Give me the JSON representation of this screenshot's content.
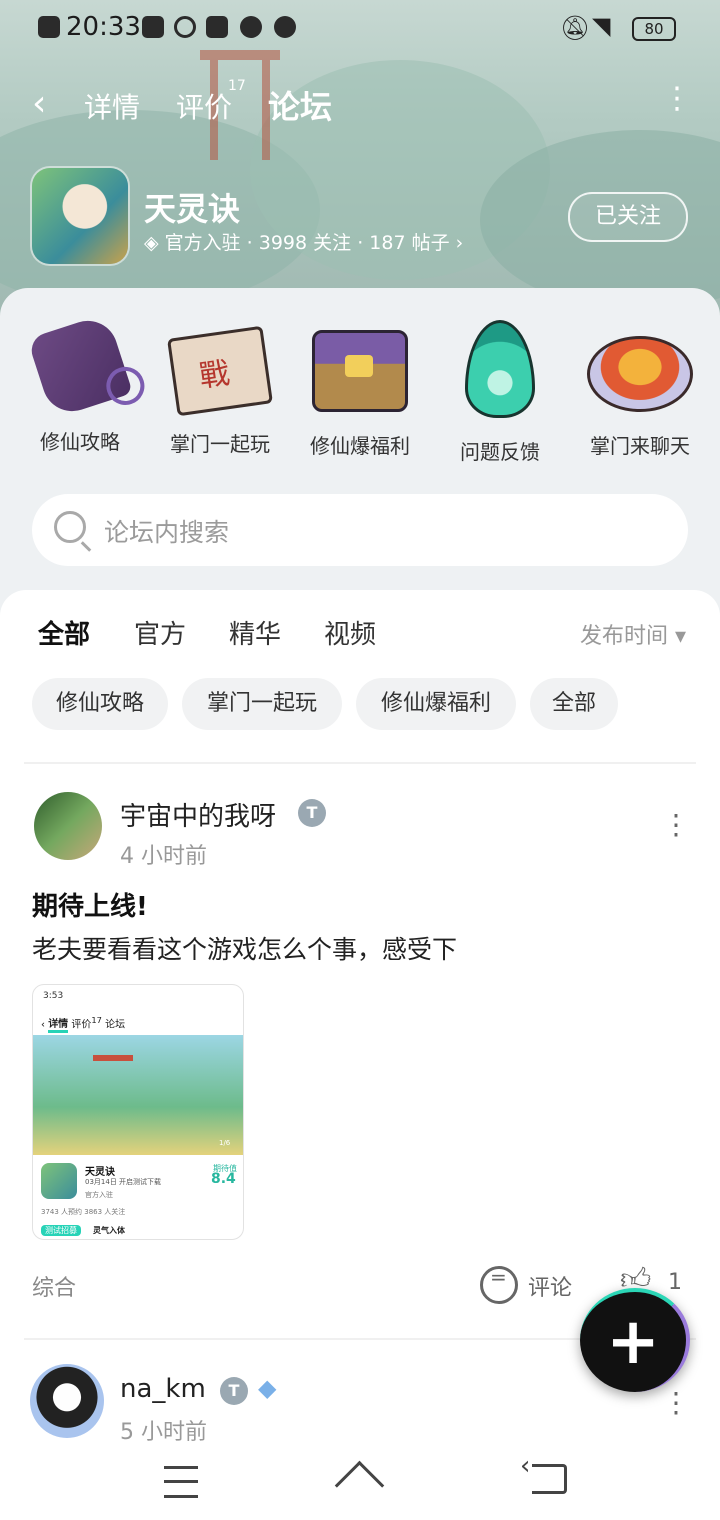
{
  "status_bar": {
    "time": "20:33",
    "battery": "80",
    "bell_icon": "bell-off-icon",
    "wifi_icon": "wifi-icon"
  },
  "nav": {
    "back_icon": "‹",
    "tabs": [
      "详情",
      "评价",
      "论坛"
    ],
    "active_tab": "论坛",
    "review_badge": "17",
    "more_icon": "⋮"
  },
  "app": {
    "name": "天灵诀",
    "official": "官方入驻",
    "meta": " · 3998 关注 · 187 帖子 ›",
    "follow_button": "已关注"
  },
  "categories": [
    {
      "label": "修仙攻略",
      "icon": "scroll-case-icon"
    },
    {
      "label": "掌门一起玩",
      "icon": "battle-scroll-icon"
    },
    {
      "label": "修仙爆福利",
      "icon": "treasure-chest-icon"
    },
    {
      "label": "问题反馈",
      "icon": "spirit-flame-icon"
    },
    {
      "label": "掌门来聊天",
      "icon": "feast-plate-icon"
    }
  ],
  "search": {
    "placeholder": "论坛内搜索"
  },
  "feed_tabs": [
    "全部",
    "官方",
    "精华",
    "视频"
  ],
  "sort_label": "发布时间 ▾",
  "chips": [
    "修仙攻略",
    "掌门一起玩",
    "修仙爆福利",
    "全部"
  ],
  "posts": [
    {
      "user": "宇宙中的我呀",
      "time": "4 小时前",
      "title": "期待上线!",
      "body": "老夫要看看这个游戏怎么个事，感受下",
      "tag": "综合",
      "comment_label": "评论",
      "likes": "1",
      "thumbnail": {
        "status_time": "3:53",
        "nav_tabs": [
          "详情",
          "评价",
          "论坛"
        ],
        "nav_badge": "17",
        "app_name": "天灵诀",
        "date_line": "03月14日 开启测试下载",
        "official": "官方入驻",
        "score_label": "期待值",
        "score": "8.4",
        "stats": "3743 人预约    3863 人关注",
        "tag": "测试招募",
        "tag_text": "灵气入体",
        "page": "1/6"
      }
    },
    {
      "user": "na_km",
      "time": "5 小时前"
    }
  ],
  "fab_icon": "+"
}
